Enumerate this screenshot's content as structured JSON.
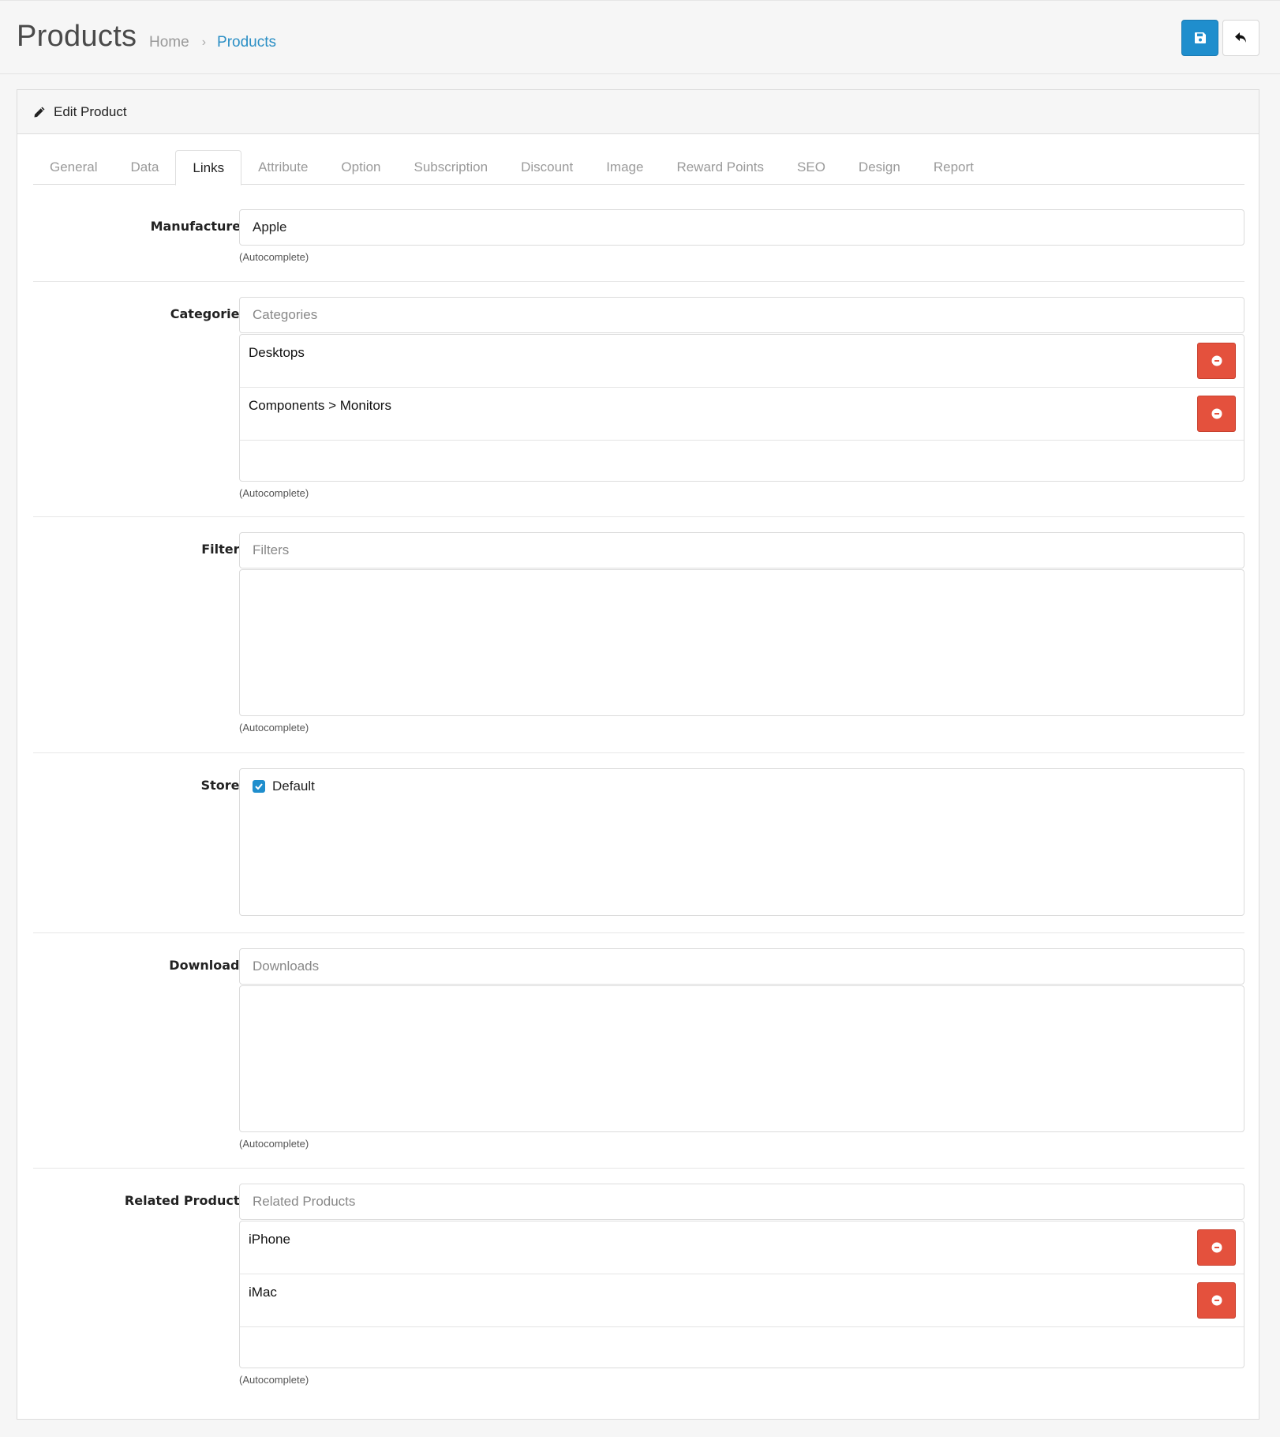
{
  "header": {
    "title": "Products",
    "breadcrumb": [
      {
        "label": "Home"
      },
      {
        "label": "Products"
      }
    ],
    "breadcrumb_separator": "›",
    "save_icon": "save-icon",
    "back_icon": "reply-icon"
  },
  "card": {
    "title": "Edit Product",
    "title_icon": "pencil-icon"
  },
  "tabs": [
    {
      "label": "General",
      "active": false
    },
    {
      "label": "Data",
      "active": false
    },
    {
      "label": "Links",
      "active": true
    },
    {
      "label": "Attribute",
      "active": false
    },
    {
      "label": "Option",
      "active": false
    },
    {
      "label": "Subscription",
      "active": false
    },
    {
      "label": "Discount",
      "active": false
    },
    {
      "label": "Image",
      "active": false
    },
    {
      "label": "Reward Points",
      "active": false
    },
    {
      "label": "SEO",
      "active": false
    },
    {
      "label": "Design",
      "active": false
    },
    {
      "label": "Report",
      "active": false
    }
  ],
  "form": {
    "manufacturer": {
      "label": "Manufacturer",
      "value": "Apple",
      "help": "(Autocomplete)"
    },
    "categories": {
      "label": "Categories",
      "placeholder": "Categories",
      "items": [
        "Desktops",
        "Components > Monitors"
      ],
      "help": "(Autocomplete)"
    },
    "filters": {
      "label": "Filters",
      "placeholder": "Filters",
      "items": [],
      "help": "(Autocomplete)"
    },
    "stores": {
      "label": "Stores",
      "options": [
        {
          "label": "Default",
          "checked": true
        }
      ]
    },
    "downloads": {
      "label": "Downloads",
      "placeholder": "Downloads",
      "items": [],
      "help": "(Autocomplete)"
    },
    "related": {
      "label": "Related Products",
      "placeholder": "Related Products",
      "items": [
        "iPhone",
        "iMac"
      ],
      "help": "(Autocomplete)"
    }
  },
  "colors": {
    "primary": "#1f8ecd",
    "danger": "#e4513d",
    "link": "#2b8fc5"
  }
}
